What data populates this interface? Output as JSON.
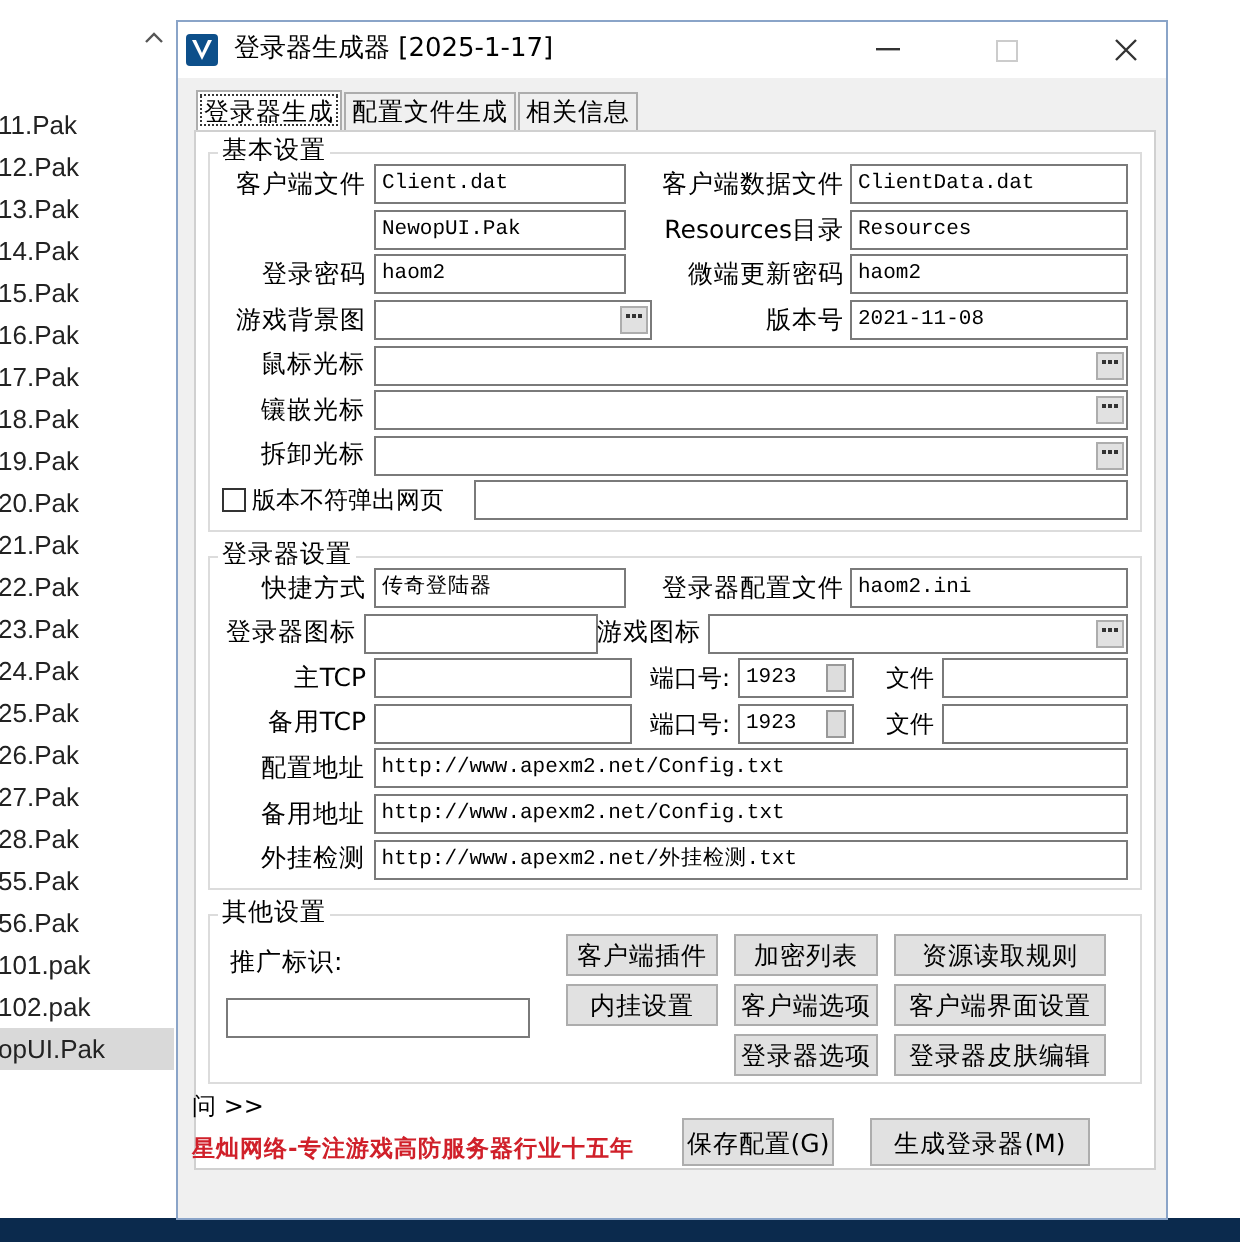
{
  "explorer": {
    "files": [
      {
        "name": "11.Pak",
        "selected": false
      },
      {
        "name": "12.Pak",
        "selected": false
      },
      {
        "name": "13.Pak",
        "selected": false
      },
      {
        "name": "14.Pak",
        "selected": false
      },
      {
        "name": "15.Pak",
        "selected": false
      },
      {
        "name": "16.Pak",
        "selected": false
      },
      {
        "name": "17.Pak",
        "selected": false
      },
      {
        "name": "18.Pak",
        "selected": false
      },
      {
        "name": "19.Pak",
        "selected": false
      },
      {
        "name": "20.Pak",
        "selected": false
      },
      {
        "name": "21.Pak",
        "selected": false
      },
      {
        "name": "22.Pak",
        "selected": false
      },
      {
        "name": "23.Pak",
        "selected": false
      },
      {
        "name": "24.Pak",
        "selected": false
      },
      {
        "name": "25.Pak",
        "selected": false
      },
      {
        "name": "26.Pak",
        "selected": false
      },
      {
        "name": "27.Pak",
        "selected": false
      },
      {
        "name": "28.Pak",
        "selected": false
      },
      {
        "name": "55.Pak",
        "selected": false
      },
      {
        "name": "56.Pak",
        "selected": false
      },
      {
        "name": "101.pak",
        "selected": false
      },
      {
        "name": "102.pak",
        "selected": false
      },
      {
        "name": "opUI.Pak",
        "selected": true
      }
    ]
  },
  "window": {
    "title": "登录器生成器 [2025-1-17]"
  },
  "tabs": [
    {
      "label": "登录器生成",
      "selected": true
    },
    {
      "label": "配置文件生成",
      "selected": false
    },
    {
      "label": "相关信息",
      "selected": false
    }
  ],
  "basic_settings": {
    "title": "基本设置",
    "rows": [
      [
        {
          "kind": "text",
          "label": "客户端文件",
          "value": "Client.dat"
        },
        {
          "kind": "text",
          "label": "客户端数据文件",
          "value": "ClientData.dat"
        }
      ],
      [
        {
          "kind": "text",
          "value": "NewopUI.Pak"
        },
        {
          "kind": "text",
          "label": "Resources目录",
          "value": "Resources"
        }
      ],
      [
        {
          "kind": "text",
          "label": "登录密码",
          "value": "haom2"
        },
        {
          "kind": "text",
          "label": "微端更新密码",
          "value": "haom2"
        }
      ],
      [
        {
          "kind": "browse",
          "label": "游戏背景图"
        },
        {
          "kind": "text",
          "label": "版本号",
          "value": "2021-11-08"
        }
      ],
      [
        {
          "kind": "wide",
          "label": "鼠标光标"
        }
      ],
      [
        {
          "kind": "wide",
          "label": "镶嵌光标"
        }
      ],
      [
        {
          "kind": "wide",
          "label": "拆卸光标"
        }
      ],
      [
        {
          "kind": "checkbox",
          "label": "版本不符弹出网页",
          "checked": false
        }
      ]
    ]
  },
  "launcher_settings": {
    "title": "登录器设置",
    "rows": [
      [
        {
          "kind": "text",
          "label": "快捷方式",
          "value": "传奇登陆器"
        },
        {
          "kind": "text",
          "label": "登录器配置文件",
          "value": "haom2.ini"
        }
      ],
      [
        {
          "kind": "text",
          "label": "登录器图标"
        },
        {
          "kind": "wide",
          "label": "游戏图标"
        }
      ],
      [
        {
          "kind": "spin",
          "label": "主TCP",
          "port_label": "端口号:",
          "port": "1923",
          "file_label": "文件"
        }
      ],
      [
        {
          "kind": "spin",
          "label": "备用TCP",
          "port_label": "端口号:",
          "port": "1923",
          "file_label": "文件"
        }
      ],
      [
        {
          "kind": "url",
          "label": "配置地址",
          "value": "http://www.apexm2.net/Config.txt"
        }
      ],
      [
        {
          "kind": "url",
          "label": "备用地址",
          "value": "http://www.apexm2.net/Config.txt"
        }
      ],
      [
        {
          "kind": "url",
          "label": "外挂检测",
          "value": "http://www.apexm2.net/外挂检测.txt"
        }
      ]
    ]
  },
  "other_settings": {
    "title": "其他设置",
    "promo_label": "推广标识:",
    "buttons": [
      [
        "客户端插件",
        "加密列表",
        "资源读取规则"
      ],
      [
        "内挂设置",
        "客户端选项",
        "客户端界面设置"
      ],
      [
        "登录器选项",
        "登录器皮肤编辑"
      ]
    ]
  },
  "footer": {
    "link": "问 >>",
    "slogan": "星灿网络-专注游戏高防服务器行业十五年",
    "buttons": [
      "保存配置(G)",
      "生成登录器(M)"
    ]
  }
}
